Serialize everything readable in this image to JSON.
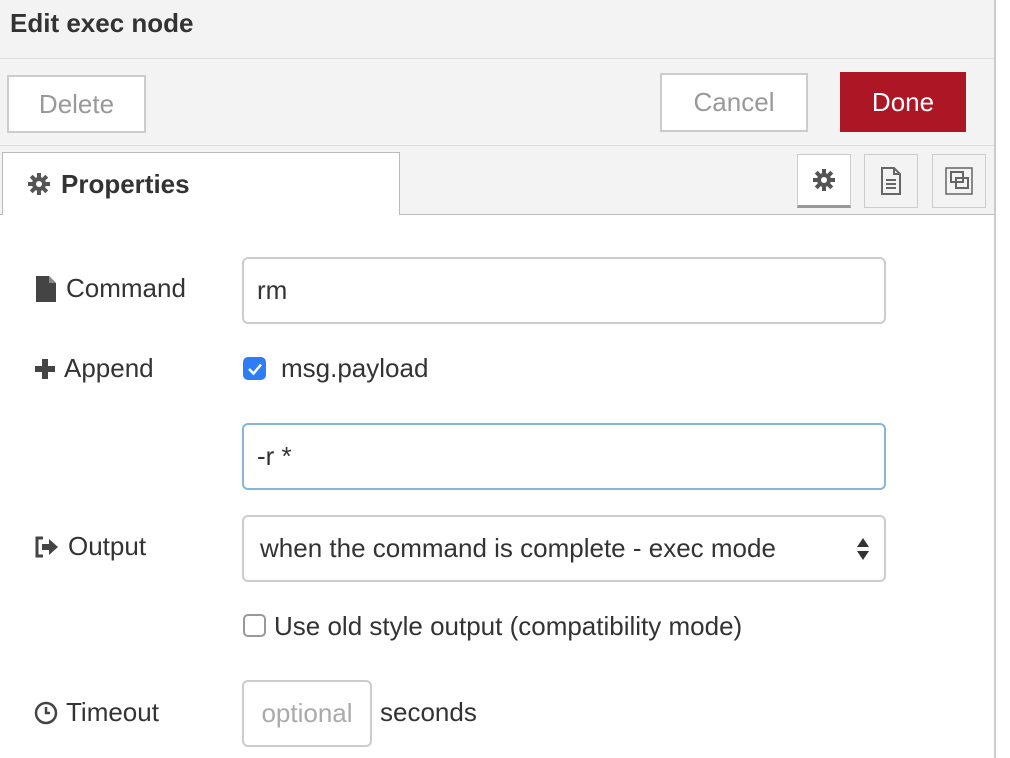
{
  "header": {
    "title": "Edit exec node"
  },
  "toolbar": {
    "delete_label": "Delete",
    "cancel_label": "Cancel",
    "done_label": "Done"
  },
  "tabs": {
    "properties_label": "Properties",
    "icon_tabs": [
      "gear-icon",
      "document-icon",
      "layout-icon"
    ]
  },
  "form": {
    "command": {
      "label": "Command",
      "value": "rm"
    },
    "append": {
      "label": "Append",
      "checkbox_label": "msg.payload",
      "checked": true,
      "extra_args": "-r *"
    },
    "output": {
      "label": "Output",
      "selected": "when the command is complete - exec mode"
    },
    "old_style": {
      "label": "Use old style output (compatibility mode)",
      "checked": false
    },
    "timeout": {
      "label": "Timeout",
      "placeholder": "optional",
      "unit": "seconds"
    }
  },
  "colors": {
    "done_button": "#ad1625",
    "checkbox_checked": "#2f7df6",
    "focus_border": "#85b7d9"
  }
}
